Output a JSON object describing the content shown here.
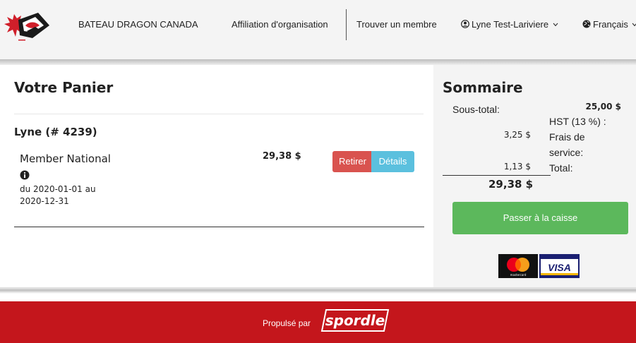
{
  "header": {
    "org_name": "BATEAU DRAGON CANADA",
    "nav_affiliation": "Affiliation d'organisation",
    "nav_find_member": "Trouver un membre",
    "user_name": "Lyne Test-Lariviere",
    "language": "Français",
    "user_icon": "user-circle-icon",
    "globe_icon": "globe-icon",
    "dropdown_icon": "chevron-down-icon"
  },
  "cart": {
    "title": "Votre Panier",
    "member": "Lyne (# 4239)",
    "item": {
      "name": "Member National",
      "info_icon": "info-circle-icon",
      "dates": "du 2020-01-01 au 2020-12-31",
      "price": "29,38 $",
      "remove_label": "Retirer",
      "details_label": "Détails"
    }
  },
  "summary": {
    "title": "Sommaire",
    "subtotal_label": "Sous-total:",
    "subtotal_value": "25,00 $",
    "hst_label": "HST (13 %) :",
    "hst_value": "3,25 $",
    "fee_label": "Frais de service:",
    "fee_value": "1,13 $",
    "total_label": "Total:",
    "total_value": "29,38 $",
    "checkout_label": "Passer à la caisse",
    "cards": [
      "mastercard",
      "VISA"
    ]
  },
  "footer": {
    "powered_by": "Propulsé par",
    "brand": "spordle"
  },
  "colors": {
    "remove_btn": "#d9534f",
    "details_btn": "#5bc0de",
    "checkout_btn": "#5cb85c",
    "footer_bg": "#c4161c"
  }
}
